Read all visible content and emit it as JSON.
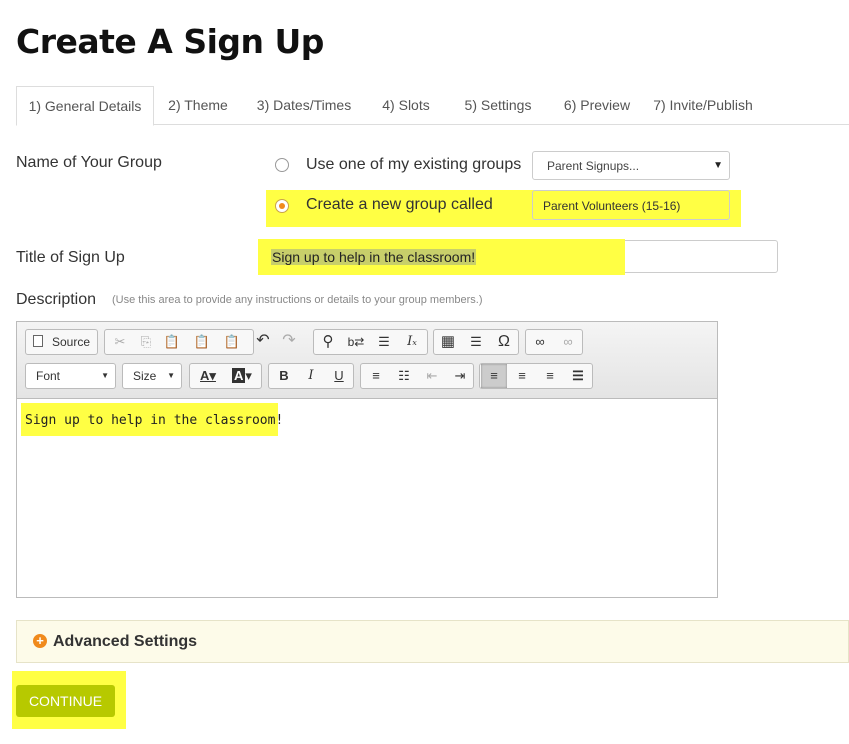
{
  "page_title": "Create A Sign Up",
  "tabs": [
    {
      "label": "1) General Details",
      "active": true
    },
    {
      "label": "2) Theme"
    },
    {
      "label": "3) Dates/Times"
    },
    {
      "label": "4) Slots"
    },
    {
      "label": "5) Settings"
    },
    {
      "label": "6) Preview"
    },
    {
      "label": "7) Invite/Publish"
    }
  ],
  "group": {
    "label": "Name of Your Group",
    "option_existing": "Use one of my existing groups",
    "existing_select_value": "Parent Signups...",
    "option_new": "Create a new group called",
    "new_group_value": "Parent Volunteers (15-16)",
    "selected": "new"
  },
  "title_field": {
    "label": "Title of Sign Up",
    "value": "Sign up to help in the classroom!"
  },
  "description": {
    "label": "Description",
    "hint": "(Use this area to provide any instructions or details to your group members.)",
    "content": "Sign up to help in the classroom!"
  },
  "editor_toolbar": {
    "source_label": "Source",
    "font_label": "Font",
    "size_label": "Size",
    "icons": [
      "cut-icon",
      "copy-icon",
      "paste-icon",
      "paste-text-icon",
      "paste-word-icon",
      "undo-icon",
      "redo-icon",
      "find-icon",
      "replace-icon",
      "select-all-icon",
      "remove-format-icon",
      "table-icon",
      "horizontal-line-icon",
      "special-char-icon",
      "link-icon",
      "unlink-icon",
      "text-color-icon",
      "bg-color-icon",
      "bold-icon",
      "italic-icon",
      "underline-icon",
      "numbered-list-icon",
      "bulleted-list-icon",
      "outdent-icon",
      "indent-icon",
      "align-left-icon",
      "align-center-icon",
      "align-right-icon",
      "justify-icon"
    ]
  },
  "advanced_settings": "Advanced Settings",
  "continue_button": "CONTINUE",
  "colors": {
    "highlight": "#ffff44",
    "accent": "#b7c900",
    "radio": "#f08a1c"
  }
}
